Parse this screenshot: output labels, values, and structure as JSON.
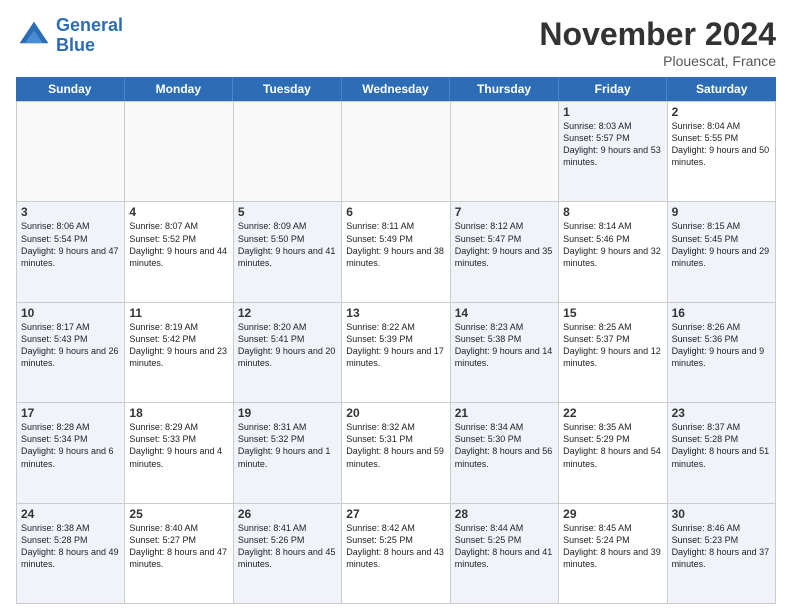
{
  "logo": {
    "line1": "General",
    "line2": "Blue"
  },
  "title": "November 2024",
  "location": "Plouescat, France",
  "header": {
    "days": [
      "Sunday",
      "Monday",
      "Tuesday",
      "Wednesday",
      "Thursday",
      "Friday",
      "Saturday"
    ]
  },
  "rows": [
    [
      {
        "day": "",
        "text": "",
        "empty": true
      },
      {
        "day": "",
        "text": "",
        "empty": true
      },
      {
        "day": "",
        "text": "",
        "empty": true
      },
      {
        "day": "",
        "text": "",
        "empty": true
      },
      {
        "day": "",
        "text": "",
        "empty": true
      },
      {
        "day": "1",
        "text": "Sunrise: 8:03 AM\nSunset: 5:57 PM\nDaylight: 9 hours\nand 53 minutes.",
        "shaded": true
      },
      {
        "day": "2",
        "text": "Sunrise: 8:04 AM\nSunset: 5:55 PM\nDaylight: 9 hours\nand 50 minutes.",
        "shaded": false
      }
    ],
    [
      {
        "day": "3",
        "text": "Sunrise: 8:06 AM\nSunset: 5:54 PM\nDaylight: 9 hours\nand 47 minutes.",
        "shaded": true
      },
      {
        "day": "4",
        "text": "Sunrise: 8:07 AM\nSunset: 5:52 PM\nDaylight: 9 hours\nand 44 minutes.",
        "shaded": false
      },
      {
        "day": "5",
        "text": "Sunrise: 8:09 AM\nSunset: 5:50 PM\nDaylight: 9 hours\nand 41 minutes.",
        "shaded": true
      },
      {
        "day": "6",
        "text": "Sunrise: 8:11 AM\nSunset: 5:49 PM\nDaylight: 9 hours\nand 38 minutes.",
        "shaded": false
      },
      {
        "day": "7",
        "text": "Sunrise: 8:12 AM\nSunset: 5:47 PM\nDaylight: 9 hours\nand 35 minutes.",
        "shaded": true
      },
      {
        "day": "8",
        "text": "Sunrise: 8:14 AM\nSunset: 5:46 PM\nDaylight: 9 hours\nand 32 minutes.",
        "shaded": false
      },
      {
        "day": "9",
        "text": "Sunrise: 8:15 AM\nSunset: 5:45 PM\nDaylight: 9 hours\nand 29 minutes.",
        "shaded": true
      }
    ],
    [
      {
        "day": "10",
        "text": "Sunrise: 8:17 AM\nSunset: 5:43 PM\nDaylight: 9 hours\nand 26 minutes.",
        "shaded": true
      },
      {
        "day": "11",
        "text": "Sunrise: 8:19 AM\nSunset: 5:42 PM\nDaylight: 9 hours\nand 23 minutes.",
        "shaded": false
      },
      {
        "day": "12",
        "text": "Sunrise: 8:20 AM\nSunset: 5:41 PM\nDaylight: 9 hours\nand 20 minutes.",
        "shaded": true
      },
      {
        "day": "13",
        "text": "Sunrise: 8:22 AM\nSunset: 5:39 PM\nDaylight: 9 hours\nand 17 minutes.",
        "shaded": false
      },
      {
        "day": "14",
        "text": "Sunrise: 8:23 AM\nSunset: 5:38 PM\nDaylight: 9 hours\nand 14 minutes.",
        "shaded": true
      },
      {
        "day": "15",
        "text": "Sunrise: 8:25 AM\nSunset: 5:37 PM\nDaylight: 9 hours\nand 12 minutes.",
        "shaded": false
      },
      {
        "day": "16",
        "text": "Sunrise: 8:26 AM\nSunset: 5:36 PM\nDaylight: 9 hours\nand 9 minutes.",
        "shaded": true
      }
    ],
    [
      {
        "day": "17",
        "text": "Sunrise: 8:28 AM\nSunset: 5:34 PM\nDaylight: 9 hours\nand 6 minutes.",
        "shaded": true
      },
      {
        "day": "18",
        "text": "Sunrise: 8:29 AM\nSunset: 5:33 PM\nDaylight: 9 hours\nand 4 minutes.",
        "shaded": false
      },
      {
        "day": "19",
        "text": "Sunrise: 8:31 AM\nSunset: 5:32 PM\nDaylight: 9 hours\nand 1 minute.",
        "shaded": true
      },
      {
        "day": "20",
        "text": "Sunrise: 8:32 AM\nSunset: 5:31 PM\nDaylight: 8 hours\nand 59 minutes.",
        "shaded": false
      },
      {
        "day": "21",
        "text": "Sunrise: 8:34 AM\nSunset: 5:30 PM\nDaylight: 8 hours\nand 56 minutes.",
        "shaded": true
      },
      {
        "day": "22",
        "text": "Sunrise: 8:35 AM\nSunset: 5:29 PM\nDaylight: 8 hours\nand 54 minutes.",
        "shaded": false
      },
      {
        "day": "23",
        "text": "Sunrise: 8:37 AM\nSunset: 5:28 PM\nDaylight: 8 hours\nand 51 minutes.",
        "shaded": true
      }
    ],
    [
      {
        "day": "24",
        "text": "Sunrise: 8:38 AM\nSunset: 5:28 PM\nDaylight: 8 hours\nand 49 minutes.",
        "shaded": true
      },
      {
        "day": "25",
        "text": "Sunrise: 8:40 AM\nSunset: 5:27 PM\nDaylight: 8 hours\nand 47 minutes.",
        "shaded": false
      },
      {
        "day": "26",
        "text": "Sunrise: 8:41 AM\nSunset: 5:26 PM\nDaylight: 8 hours\nand 45 minutes.",
        "shaded": true
      },
      {
        "day": "27",
        "text": "Sunrise: 8:42 AM\nSunset: 5:25 PM\nDaylight: 8 hours\nand 43 minutes.",
        "shaded": false
      },
      {
        "day": "28",
        "text": "Sunrise: 8:44 AM\nSunset: 5:25 PM\nDaylight: 8 hours\nand 41 minutes.",
        "shaded": true
      },
      {
        "day": "29",
        "text": "Sunrise: 8:45 AM\nSunset: 5:24 PM\nDaylight: 8 hours\nand 39 minutes.",
        "shaded": false
      },
      {
        "day": "30",
        "text": "Sunrise: 8:46 AM\nSunset: 5:23 PM\nDaylight: 8 hours\nand 37 minutes.",
        "shaded": true
      }
    ]
  ]
}
